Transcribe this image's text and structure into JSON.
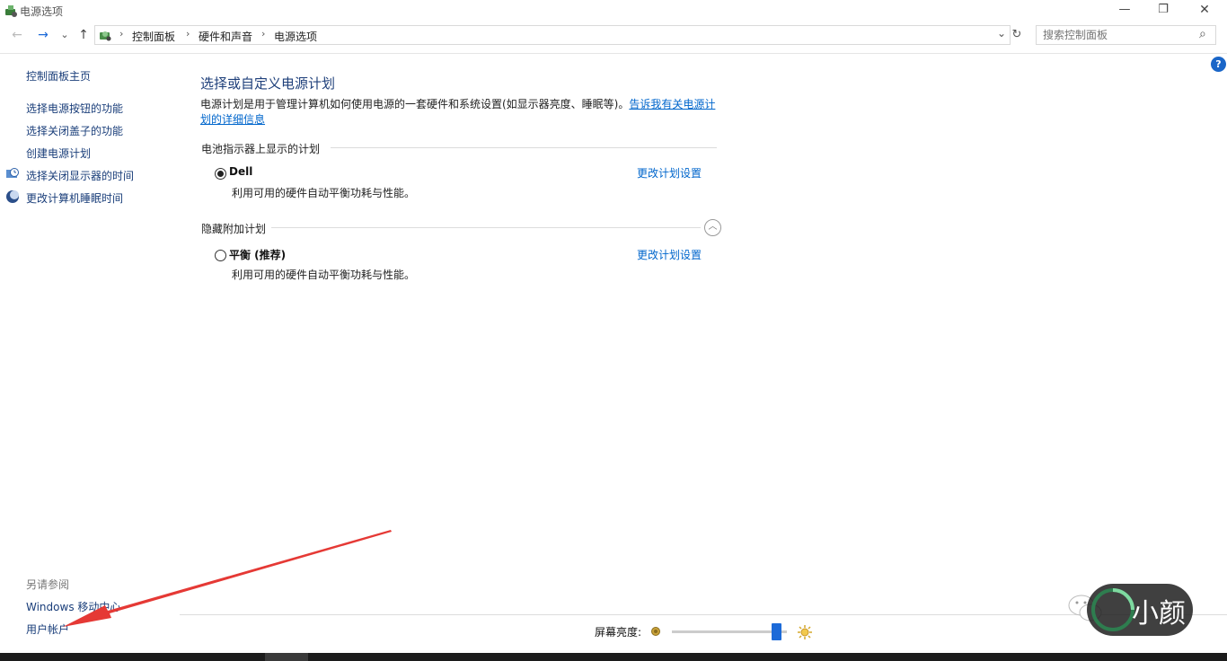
{
  "window": {
    "title": "电源选项",
    "minimize_glyph": "—",
    "maximize_glyph": "❐",
    "close_glyph": "✕"
  },
  "nav": {
    "back_glyph": "←",
    "forward_glyph": "→",
    "recent_glyph": "⌄",
    "up_glyph": "↑",
    "refresh_glyph": "↻",
    "dropdown_glyph": "⌄"
  },
  "breadcrumb": {
    "items": [
      "控制面板",
      "硬件和声音",
      "电源选项"
    ],
    "separator": "›"
  },
  "search": {
    "placeholder": "搜索控制面板",
    "icon_glyph": "⌕"
  },
  "sidebar": {
    "home": "控制面板主页",
    "items": [
      "选择电源按钮的功能",
      "选择关闭盖子的功能",
      "创建电源计划",
      "选择关闭显示器的时间",
      "更改计算机睡眠时间"
    ],
    "see_also_title": "另请参阅",
    "see_also": [
      "Windows 移动中心",
      "用户帐户"
    ]
  },
  "main": {
    "title": "选择或自定义电源计划",
    "description": "电源计划是用于管理计算机如何使用电源的一套硬件和系统设置(如显示器亮度、睡眠等)。",
    "description_link_a": "告诉我有关电源计",
    "description_link_b": "划的详细信息",
    "battery_section": "电池指示器上显示的计划",
    "hidden_section": "隐藏附加计划",
    "collapse_glyph": "︿",
    "plans": [
      {
        "name": "Dell",
        "desc": "利用可用的硬件自动平衡功耗与性能。",
        "link": "更改计划设置",
        "selected": true
      },
      {
        "name": "平衡 (推荐)",
        "desc": "利用可用的硬件自动平衡功耗与性能。",
        "link": "更改计划设置",
        "selected": false
      }
    ],
    "help_glyph": "?"
  },
  "brightness": {
    "label": "屏幕亮度:",
    "level": 0.95
  },
  "watermark": {
    "text": "小颜"
  },
  "colors": {
    "accent": "#1c6ad8",
    "link": "#0066cc",
    "arrow": "#e53935"
  }
}
